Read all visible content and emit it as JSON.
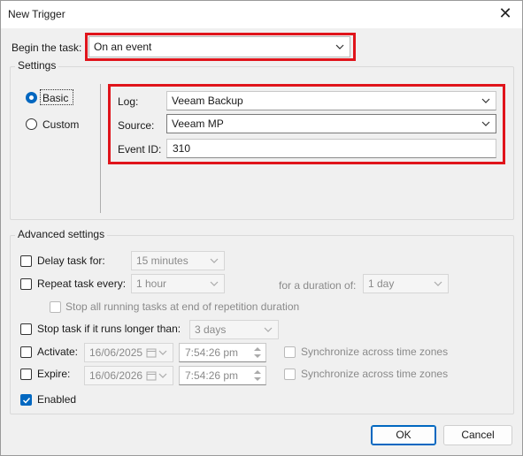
{
  "window": {
    "title": "New Trigger",
    "close_glyph": "✕"
  },
  "begin": {
    "label": "Begin the task:",
    "value": "On an event"
  },
  "settings": {
    "title": "Settings",
    "radios": {
      "basic": "Basic",
      "custom": "Custom",
      "selected": "basic"
    },
    "log": {
      "label": "Log:",
      "value": "Veeam Backup"
    },
    "source": {
      "label": "Source:",
      "value": "Veeam MP"
    },
    "event_id": {
      "label": "Event ID:",
      "value": "310"
    }
  },
  "advanced": {
    "title": "Advanced settings",
    "delay": {
      "label": "Delay task for:",
      "value": "15 minutes"
    },
    "repeat": {
      "label": "Repeat task every:",
      "value": "1 hour",
      "duration_label": "for a duration of:",
      "duration_value": "1 day"
    },
    "stop_all": {
      "label": "Stop all running tasks at end of repetition duration"
    },
    "stop_long": {
      "label": "Stop task if it runs longer than:",
      "value": "3 days"
    },
    "activate": {
      "label": "Activate:",
      "date": "16/06/2025",
      "time": "7:54:26 pm",
      "sync": "Synchronize across time zones"
    },
    "expire": {
      "label": "Expire:",
      "date": "16/06/2026",
      "time": "7:54:26 pm",
      "sync": "Synchronize across time zones"
    },
    "enabled": {
      "label": "Enabled",
      "checked": true
    }
  },
  "buttons": {
    "ok": "OK",
    "cancel": "Cancel"
  },
  "colors": {
    "highlight": "#e0141b",
    "accent": "#0067c0"
  }
}
